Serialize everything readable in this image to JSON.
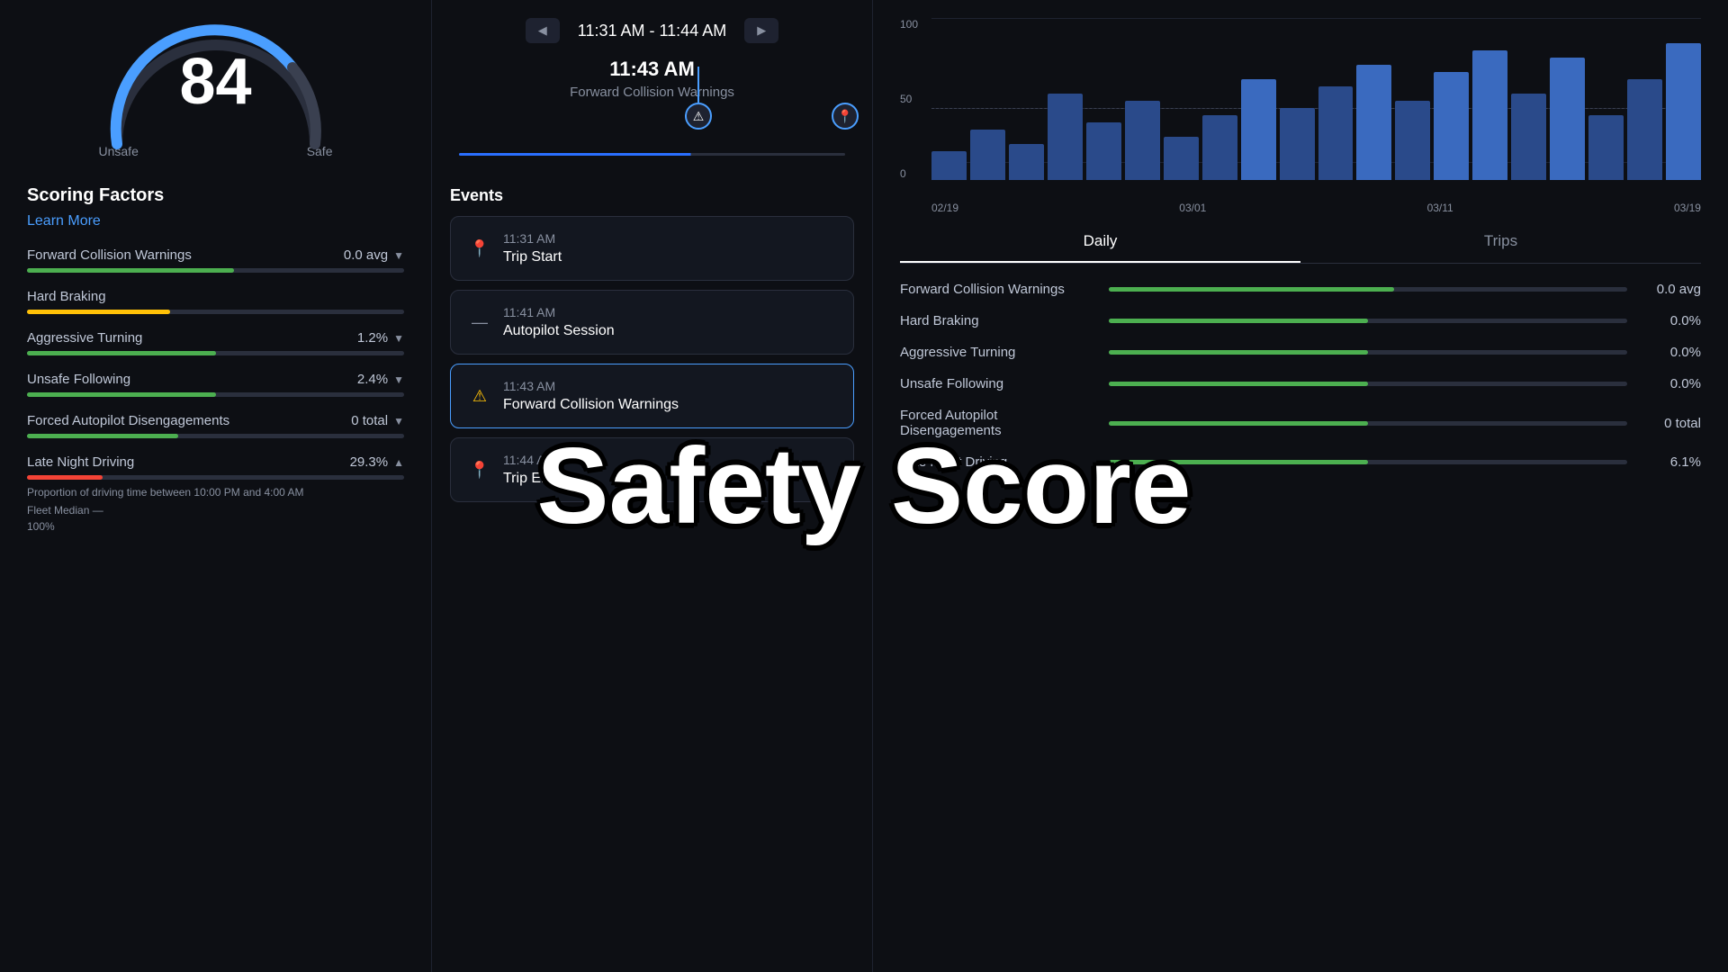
{
  "left": {
    "score": "84",
    "score_label_unsafe": "Unsafe",
    "score_label_safe": "Safe",
    "scoring_factors_title": "Scoring Factors",
    "learn_more": "Learn More",
    "factors": [
      {
        "name": "Forward Collision Warnings",
        "value": "0.0 avg",
        "bar_width": "55%",
        "bar_color": "green",
        "has_chevron": true
      },
      {
        "name": "Hard Braking",
        "value": "",
        "bar_width": "38%",
        "bar_color": "yellow",
        "has_chevron": false
      },
      {
        "name": "Aggressive Turning",
        "value": "1.2%",
        "bar_width": "50%",
        "bar_color": "green",
        "has_chevron": true
      },
      {
        "name": "Unsafe Following",
        "value": "2.4%",
        "bar_width": "50%",
        "bar_color": "green",
        "has_chevron": true
      },
      {
        "name": "Forced Autopilot Disengagements",
        "value": "0 total",
        "bar_width": "40%",
        "bar_color": "green",
        "has_chevron": true
      },
      {
        "name": "Late Night Driving",
        "value": "29.3%",
        "bar_width": "20%",
        "bar_color": "red",
        "has_chevron": true,
        "is_late_night": true
      }
    ],
    "late_night_desc": "Proportion of driving time between 10:00 PM and 4:00 AM",
    "fleet_median_label": "Fleet Median",
    "hundred_percent": "100%"
  },
  "center": {
    "trip_time_range": "11:31 AM - 11:44 AM",
    "selected_event_time": "11:43 AM",
    "selected_event_name": "Forward Collision Warnings",
    "events_label": "Events",
    "events": [
      {
        "time": "11:31 AM",
        "name": "Trip Start",
        "icon": "📍",
        "is_warning": false,
        "is_active": false
      },
      {
        "time": "11:41 AM",
        "name": "Autopilot Session",
        "icon": "–",
        "is_warning": false,
        "is_active": false
      },
      {
        "time": "11:43 AM",
        "name": "Forward Collision Warnings",
        "icon": "⚠",
        "is_warning": true,
        "is_active": true
      },
      {
        "time": "11:44 AM",
        "name": "Trip End",
        "icon": "📍",
        "is_warning": false,
        "is_active": false
      }
    ]
  },
  "overlay": {
    "text": "Safety Score"
  },
  "right": {
    "chart": {
      "y_labels": [
        "100",
        "50",
        "0"
      ],
      "x_labels": [
        "02/19",
        "03/01",
        "03/11",
        "03/19"
      ],
      "bars": [
        20,
        35,
        25,
        60,
        40,
        55,
        30,
        45,
        70,
        50,
        65,
        80,
        55,
        75,
        90,
        60,
        85,
        45,
        70,
        95
      ]
    },
    "tabs": [
      {
        "label": "Daily",
        "active": true
      },
      {
        "label": "Trips",
        "active": false
      }
    ],
    "factors": [
      {
        "name": "Forward Collision Warnings",
        "value": "0.0 avg",
        "bar_width": "55%",
        "bar_color": "green"
      },
      {
        "name": "Hard Braking",
        "value": "0.0%",
        "bar_width": "50%",
        "bar_color": "green"
      },
      {
        "name": "Aggressive Turning",
        "value": "0.0%",
        "bar_width": "50%",
        "bar_color": "green"
      },
      {
        "name": "Unsafe Following",
        "value": "0.0%",
        "bar_width": "50%",
        "bar_color": "green"
      },
      {
        "name": "Forced Autopilot Disengagements",
        "value": "0 total",
        "bar_width": "50%",
        "bar_color": "green"
      },
      {
        "name": "Late Night Driving",
        "value": "6.1%",
        "bar_width": "50%",
        "bar_color": "green"
      }
    ]
  }
}
